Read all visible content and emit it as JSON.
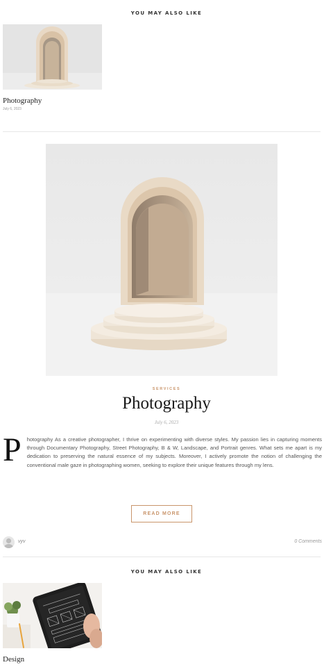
{
  "related_top": {
    "heading": "YOU MAY ALSO LIKE",
    "posts": [
      {
        "title": "Photography",
        "date": "July 6, 2023"
      }
    ]
  },
  "post": {
    "category": "SERVICES",
    "title": "Photography",
    "date": "July 6, 2023",
    "dropcap": "P",
    "excerpt": "hotography As a creative photographer, I thrive on experimenting with diverse styles. My passion lies in capturing moments through Documentary Photography, Street Photography, B & W, Landscape, and Portrait genres. What sets me apart is my dedication to preserving the natural essence of my subjects. Moreover, I actively promote the notion of challenging the conventional male gaze in photographing women, seeking to explore their unique features through my lens.",
    "read_more_label": "READ MORE",
    "author": "vyv",
    "comments": "0 Comments"
  },
  "related_bottom": {
    "heading": "YOU MAY ALSO LIKE",
    "posts": [
      {
        "title": "Design"
      }
    ]
  },
  "colors": {
    "accent": "#c9956b",
    "divider": "#e7e7e7",
    "arch": "#e3cfb7"
  }
}
